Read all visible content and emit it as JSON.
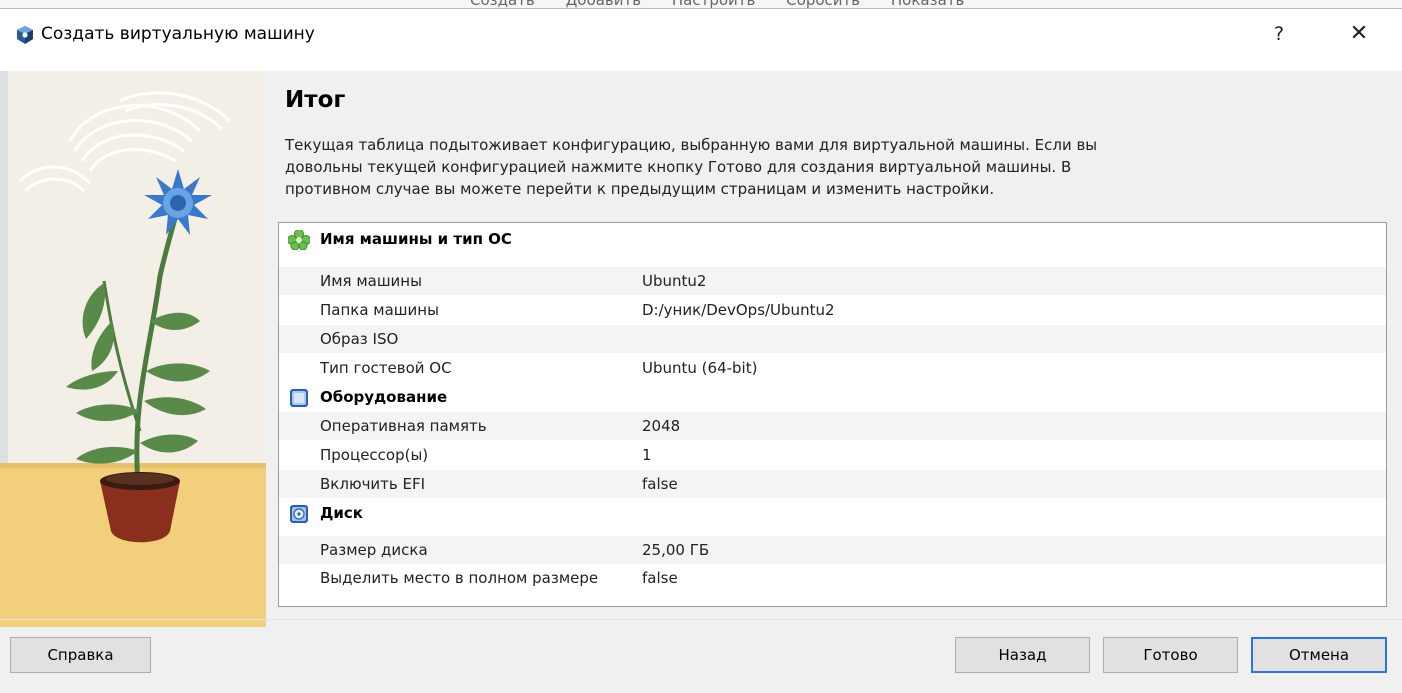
{
  "background_menu": [
    "Создать",
    "Добавить",
    "Настроить",
    "Сбросить",
    "Показать"
  ],
  "dialog": {
    "title": "Создать виртуальную машину",
    "help_label": "?",
    "close_label": "✕"
  },
  "page": {
    "heading": "Итог",
    "intro_lines": [
      "Текущая таблица подытоживает конфигурацию, выбранную вами для виртуальной машины. Если вы",
      "довольны текущей конфигурацией нажмите кнопку Готово для создания виртуальной машины. В",
      "противном случае вы можете перейти к предыдущим страницам и изменить настройки."
    ]
  },
  "summary": {
    "general": {
      "title": "Имя машины и тип ОС",
      "icon": "general-settings-icon",
      "rows": [
        {
          "key": "Имя машины",
          "value": "Ubuntu2"
        },
        {
          "key": "Папка машины",
          "value": "D:/уник/DevOps/Ubuntu2"
        },
        {
          "key": "Образ ISO",
          "value": ""
        },
        {
          "key": "Тип гостевой ОС",
          "value": "Ubuntu (64-bit)"
        }
      ]
    },
    "hardware": {
      "title": "Оборудование",
      "icon": "chip-icon",
      "rows": [
        {
          "key": "Оперативная память",
          "value": "2048"
        },
        {
          "key": "Процессор(ы)",
          "value": "1"
        },
        {
          "key": "Включить EFI",
          "value": "false"
        }
      ]
    },
    "disk": {
      "title": "Диск",
      "icon": "hard-disk-icon",
      "rows": [
        {
          "key": "Размер диска",
          "value": "25,00 ГБ"
        },
        {
          "key": "Выделить место в полном размере",
          "value": "false"
        }
      ]
    }
  },
  "buttons": {
    "help": "Справка",
    "back": "Назад",
    "finish": "Готово",
    "cancel": "Отмена"
  },
  "colors": {
    "accent": "#2c76d1",
    "flower": "#3a78c9",
    "sand": "#f2cf7a",
    "pot": "#8a2e1e",
    "leaf": "#5a8a4a"
  }
}
